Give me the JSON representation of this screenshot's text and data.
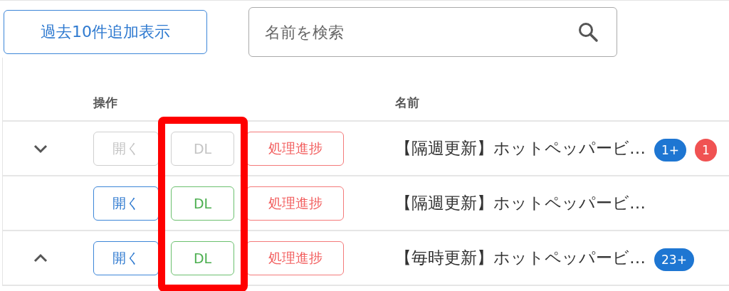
{
  "toolbar": {
    "load_more_button": "過去10件追加表示",
    "search": {
      "placeholder": "名前を検索"
    }
  },
  "table": {
    "columns": [
      {
        "label": "操作"
      },
      {
        "label": "名前"
      }
    ],
    "rows": [
      {
        "expanded": true,
        "open_button": {
          "label": "開く",
          "disabled": true
        },
        "dl_button": {
          "label": "DL",
          "disabled": true
        },
        "progress_button": "処理進捗",
        "name": "【隔週更新】ホットペッパービ…",
        "badges": [
          {
            "text": "1+",
            "color": "#1e76d2"
          },
          {
            "text": "1",
            "color": "#f05252"
          }
        ]
      },
      {
        "open_button": {
          "label": "開く",
          "disabled": false
        },
        "dl_button": {
          "label": "DL",
          "disabled": false
        },
        "progress_button": "処理進捗",
        "name": "【隔週更新】ホットペッパービ…"
      },
      {
        "expanded": false,
        "open_button": {
          "label": "開く",
          "disabled": false
        },
        "dl_button": {
          "label": "DL",
          "disabled": false
        },
        "progress_button": "処理進捗",
        "name": "【毎時更新】ホットペッパービ…",
        "badges": [
          {
            "text": "23+",
            "color": "#1e76d2"
          }
        ]
      }
    ]
  },
  "dl_column_highlighted": true
}
